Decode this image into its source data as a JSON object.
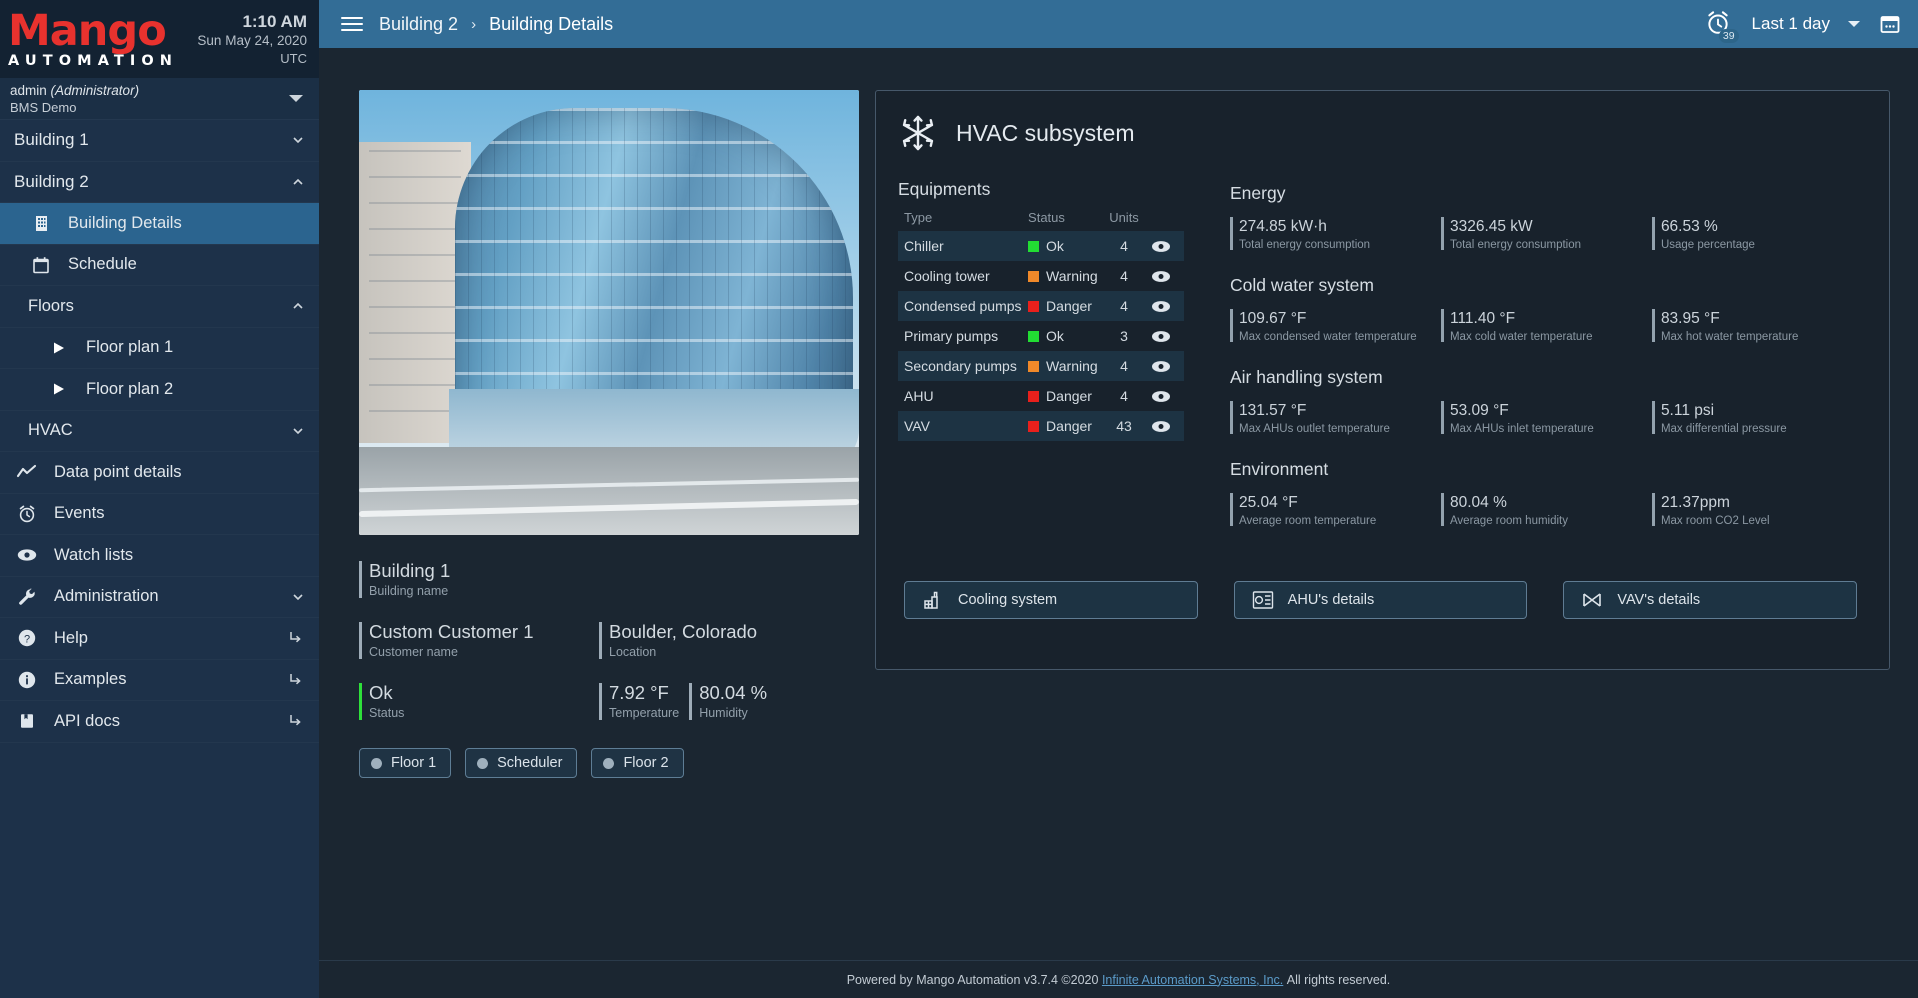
{
  "brand": {
    "logo_primary": "Mango",
    "logo_secondary": "AUTOMATION"
  },
  "clock": {
    "time": "1:10 AM",
    "date": "Sun May 24, 2020",
    "timezone": "UTC"
  },
  "user": {
    "name": "admin",
    "role": "(Administrator)",
    "instance": "BMS Demo"
  },
  "sidebar": {
    "items": [
      {
        "label": "Building 1",
        "icon": "none",
        "type": "group",
        "chevron": "down",
        "active": false
      },
      {
        "label": "Building 2",
        "icon": "none",
        "type": "group",
        "chevron": "up",
        "active": false
      },
      {
        "label": "Building Details",
        "icon": "building-icon",
        "type": "sub",
        "active": true
      },
      {
        "label": "Schedule",
        "icon": "calendar-icon",
        "type": "sub",
        "active": false
      },
      {
        "label": "Floors",
        "icon": "none",
        "type": "sublabel",
        "chevron": "up",
        "active": false
      },
      {
        "label": "Floor plan 1",
        "icon": "play-icon",
        "type": "sub2",
        "active": false
      },
      {
        "label": "Floor plan 2",
        "icon": "play-icon",
        "type": "sub2",
        "active": false
      },
      {
        "label": "HVAC",
        "icon": "none",
        "type": "sublabel",
        "chevron": "down",
        "active": false
      },
      {
        "label": "Data point details",
        "icon": "chart-line-icon",
        "type": "item",
        "active": false
      },
      {
        "label": "Events",
        "icon": "alarm-icon",
        "type": "item",
        "active": false
      },
      {
        "label": "Watch lists",
        "icon": "eye-icon",
        "type": "item",
        "active": false
      },
      {
        "label": "Administration",
        "icon": "wrench-icon",
        "type": "item",
        "chevron": "down",
        "active": false
      },
      {
        "label": "Help",
        "icon": "help-circle-icon",
        "type": "item",
        "external": true,
        "active": false
      },
      {
        "label": "Examples",
        "icon": "info-circle-icon",
        "type": "item",
        "external": true,
        "active": false
      },
      {
        "label": "API docs",
        "icon": "book-icon",
        "type": "item",
        "external": true,
        "active": false
      }
    ]
  },
  "topbar": {
    "breadcrumb_parent": "Building 2",
    "breadcrumb_separator": "›",
    "breadcrumb_current": "Building Details",
    "alarm_count": "39",
    "range_label": "Last 1 day"
  },
  "building": {
    "name_value": "Building 1",
    "name_label": "Building name",
    "customer_value": "Custom Customer 1",
    "customer_label": "Customer name",
    "location_value": "Boulder, Colorado",
    "location_label": "Location",
    "status_value": "Ok",
    "status_label": "Status",
    "temperature_value": "7.92 °F",
    "temperature_label": "Temperature",
    "humidity_value": "80.04 %",
    "humidity_label": "Humidity",
    "chips": [
      {
        "label": "Floor 1"
      },
      {
        "label": "Scheduler"
      },
      {
        "label": "Floor 2"
      }
    ]
  },
  "hvac": {
    "title": "HVAC subsystem",
    "equipments_title": "Equipments",
    "table": {
      "headers": [
        "Type",
        "Status",
        "Units",
        ""
      ],
      "rows": [
        {
          "type": "Chiller",
          "status": "Ok",
          "color": "#22dd33",
          "units": "4"
        },
        {
          "type": "Cooling tower",
          "status": "Warning",
          "color": "#f0892a",
          "units": "4"
        },
        {
          "type": "Condensed pumps",
          "status": "Danger",
          "color": "#e8201c",
          "units": "4"
        },
        {
          "type": "Primary pumps",
          "status": "Ok",
          "color": "#22dd33",
          "units": "3"
        },
        {
          "type": "Secondary pumps",
          "status": "Warning",
          "color": "#f0892a",
          "units": "4"
        },
        {
          "type": "AHU",
          "status": "Danger",
          "color": "#e8201c",
          "units": "4"
        },
        {
          "type": "VAV",
          "status": "Danger",
          "color": "#e8201c",
          "units": "43"
        }
      ]
    },
    "groups": [
      {
        "title": "Energy",
        "metrics": [
          {
            "value": "274.85 kW·h",
            "label": "Total energy consumption"
          },
          {
            "value": "3326.45 kW",
            "label": "Total energy consumption"
          },
          {
            "value": "66.53 %",
            "label": "Usage percentage"
          }
        ]
      },
      {
        "title": "Cold water system",
        "metrics": [
          {
            "value": "109.67 °F",
            "label": "Max condensed water temperature"
          },
          {
            "value": "111.40 °F",
            "label": "Max cold water temperature"
          },
          {
            "value": "83.95 °F",
            "label": "Max hot water temperature"
          }
        ]
      },
      {
        "title": "Air handling system",
        "metrics": [
          {
            "value": "131.57 °F",
            "label": "Max AHUs outlet temperature"
          },
          {
            "value": "53.09 °F",
            "label": "Max AHUs inlet temperature"
          },
          {
            "value": "5.11 psi",
            "label": "Max differential pressure"
          }
        ]
      },
      {
        "title": "Environment",
        "metrics": [
          {
            "value": "25.04 °F",
            "label": "Average room temperature"
          },
          {
            "value": "80.04 %",
            "label": "Average room humidity"
          },
          {
            "value": "21.37ppm",
            "label": "Max room CO2 Level"
          }
        ]
      }
    ],
    "buttons": [
      {
        "label": "Cooling system",
        "icon": "cooling-tower-icon"
      },
      {
        "label": "AHU's details",
        "icon": "report-icon"
      },
      {
        "label": "VAV's details",
        "icon": "valve-icon"
      }
    ]
  },
  "footer": {
    "text_before": "Powered by Mango Automation v3.7.4 ©2020",
    "link": "Infinite Automation Systems, Inc.",
    "text_after": "All rights reserved."
  },
  "colors": {
    "accent_blue": "#336d96",
    "sidebar_bg": "#1d3149",
    "status_ok": "#22dd33",
    "status_warning": "#f0892a",
    "status_danger": "#e8201c"
  }
}
